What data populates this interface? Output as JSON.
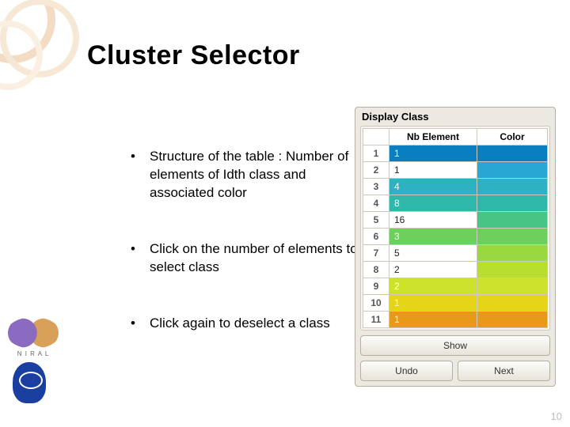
{
  "title": "Cluster Selector",
  "bullets": [
    "Structure of the table : Number of elements of Idth class and associated color",
    "Click on the number of elements to select class",
    "Click again to deselect a class"
  ],
  "panel": {
    "heading": "Display Class",
    "columns": {
      "index": "",
      "nb": "Nb Element",
      "color": "Color"
    },
    "rows": [
      {
        "idx": "1",
        "nb": "1",
        "selected": true,
        "bg": "#0a7fbf",
        "color": "#0a7fbf"
      },
      {
        "idx": "2",
        "nb": "1",
        "selected": false,
        "bg": "#ffffff",
        "color": "#28a6d4"
      },
      {
        "idx": "3",
        "nb": "4",
        "selected": true,
        "bg": "#2fb1c4",
        "color": "#2fb1c4"
      },
      {
        "idx": "4",
        "nb": "8",
        "selected": true,
        "bg": "#2fb8a9",
        "color": "#2fb8a9"
      },
      {
        "idx": "5",
        "nb": "16",
        "selected": false,
        "bg": "#ffffff",
        "color": "#46c585"
      },
      {
        "idx": "6",
        "nb": "3",
        "selected": true,
        "bg": "#6ccf5e",
        "color": "#6ccf5e"
      },
      {
        "idx": "7",
        "nb": "5",
        "selected": false,
        "bg": "#ffffff",
        "color": "#99d93f"
      },
      {
        "idx": "8",
        "nb": "2",
        "selected": false,
        "bg": "#ffffff",
        "color": "#b8df2e"
      },
      {
        "idx": "9",
        "nb": "2",
        "selected": true,
        "bg": "#cde22a",
        "color": "#cde22a"
      },
      {
        "idx": "10",
        "nb": "1",
        "selected": true,
        "bg": "#e6d418",
        "color": "#e6d418"
      },
      {
        "idx": "11",
        "nb": "1",
        "selected": true,
        "bg": "#e69a18",
        "color": "#e69a18"
      }
    ],
    "buttons": {
      "show": "Show",
      "undo": "Undo",
      "next": "Next"
    }
  },
  "page_number": "10"
}
